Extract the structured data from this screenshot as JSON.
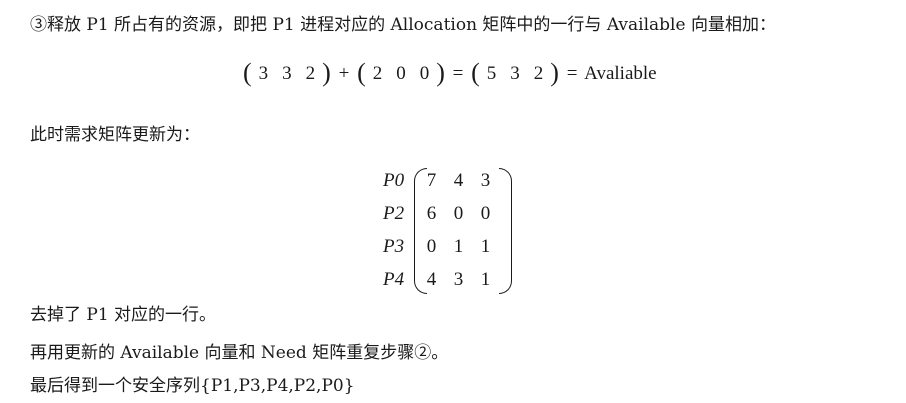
{
  "para1": "③释放 P1 所占有的资源，即把 P1 进程对应的 Allocation 矩阵中的一行与 Available 向量相加：",
  "formula": {
    "vec1": [
      "3",
      "3",
      "2"
    ],
    "plus": "+",
    "vec2": [
      "2",
      "0",
      "0"
    ],
    "equals1": "=",
    "vec3": [
      "5",
      "3",
      "2"
    ],
    "equals2": "=",
    "result": "Avaliable"
  },
  "para2": "此时需求矩阵更新为：",
  "matrix": {
    "rows": [
      {
        "label": "P0",
        "values": [
          "7",
          "4",
          "3"
        ]
      },
      {
        "label": "P2",
        "values": [
          "6",
          "0",
          "0"
        ]
      },
      {
        "label": "P3",
        "values": [
          "0",
          "1",
          "1"
        ]
      },
      {
        "label": "P4",
        "values": [
          "4",
          "3",
          "1"
        ]
      }
    ]
  },
  "para3": "去掉了 P1 对应的一行。",
  "para4": "再用更新的 Available 向量和 Need 矩阵重复步骤②。",
  "para5": "最后得到一个安全序列{P1,P3,P4,P2,P0}"
}
